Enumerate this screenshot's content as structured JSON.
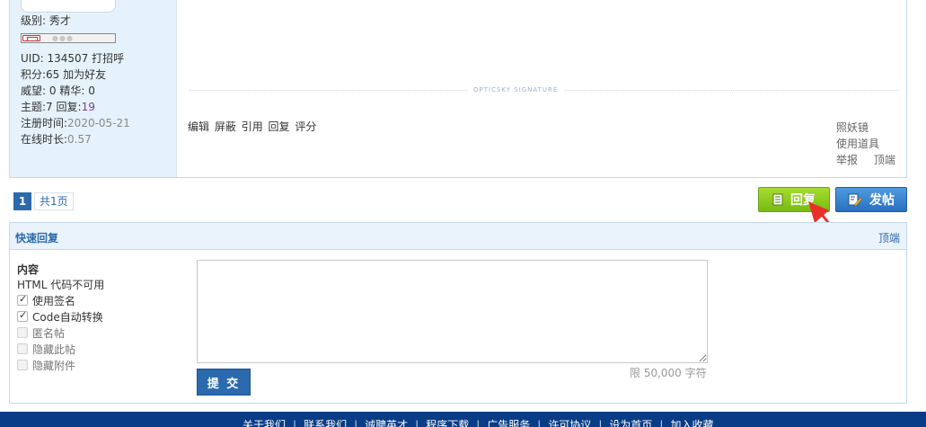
{
  "profile": {
    "level_label": "级别:",
    "level_value": "秀才",
    "uid_label": "UID:",
    "uid_value": "134507",
    "greet_link": "打招呼",
    "points_label": "积分:",
    "points_value": "65",
    "add_friend_link": "加为好友",
    "prestige_label": "威望:",
    "prestige_value": "0",
    "elite_label": "精华:",
    "elite_value": "0",
    "topics_label": "主题:",
    "topics_value": "7",
    "replies_label": "回复:",
    "replies_value": "19",
    "register_label": "注册时间:",
    "register_value": "2020-05-21",
    "online_label": "在线时长:",
    "online_value": "0.57"
  },
  "signature": {
    "divider_text": "OPTICSKY SIGNATURE"
  },
  "post_actions": [
    "编辑",
    "屏蔽",
    "引用",
    "回复",
    "评分"
  ],
  "side_links": {
    "mirror": "照妖镜",
    "use_item": "使用道具",
    "report": "举报",
    "top": "顶端"
  },
  "pagination": {
    "current": "1",
    "total": "共1页"
  },
  "buttons": {
    "reply": "回复",
    "new_post": "发帖",
    "reply_color": "#86c21c",
    "post_color": "#2f7ac8"
  },
  "quick_reply": {
    "title": "快速回复",
    "top_link": "顶端",
    "content_label": "内容",
    "html_note": "HTML 代码不可用",
    "options": [
      {
        "label": "使用签名",
        "checked": true,
        "disabled": false
      },
      {
        "label": "Code自动转换",
        "checked": true,
        "disabled": false
      },
      {
        "label": "匿名帖",
        "checked": false,
        "disabled": true
      },
      {
        "label": "隐藏此帖",
        "checked": false,
        "disabled": true
      },
      {
        "label": "隐藏附件",
        "checked": false,
        "disabled": true
      }
    ],
    "textarea_value": "",
    "limit_text": "限 50,000 字符",
    "submit_label": "提 交"
  },
  "footer": {
    "links": [
      "关于我们",
      "联系我们",
      "诚聘英才",
      "程序下载",
      "广告服务",
      "许可协议",
      "设为首页",
      "加入收藏"
    ]
  }
}
